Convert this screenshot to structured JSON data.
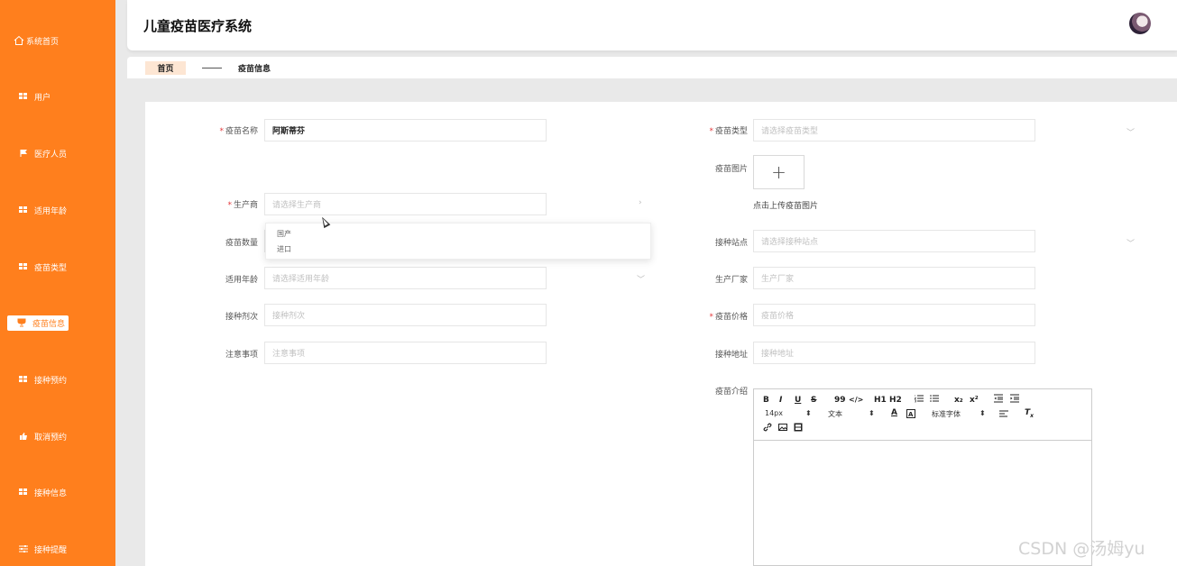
{
  "app": {
    "title": "儿童疫苗医疗系统"
  },
  "sidebar": {
    "items": [
      {
        "label": "系统首页",
        "icon": "home-icon"
      },
      {
        "label": "用户",
        "icon": "grid-icon"
      },
      {
        "label": "医疗人员",
        "icon": "flag-icon"
      },
      {
        "label": "适用年龄",
        "icon": "grid-icon"
      },
      {
        "label": "疫苗类型",
        "icon": "grid-icon"
      },
      {
        "label": "疫苗信息",
        "icon": "cup-icon"
      },
      {
        "label": "接种预约",
        "icon": "grid-icon"
      },
      {
        "label": "取消预约",
        "icon": "thumb-icon"
      },
      {
        "label": "接种信息",
        "icon": "grid-icon"
      },
      {
        "label": "接种提醒",
        "icon": "sliders-icon"
      }
    ],
    "active": "疫苗信息",
    "color": "#ff7f1d"
  },
  "breadcrumb": {
    "home": "首页",
    "current": "疫苗信息"
  },
  "form": {
    "vaccine_name": {
      "label": "疫苗名称",
      "value": "阿斯蒂芬"
    },
    "vaccine_type": {
      "label": "疫苗类型",
      "placeholder": "请选择疫苗类型"
    },
    "vaccine_image": {
      "label": "疫苗图片",
      "upload_symbol": "+",
      "tip": "点击上传疫苗图片"
    },
    "manufacturer": {
      "label": "生产商",
      "placeholder": "请选择生产商"
    },
    "manufacturer_options": [
      "国产",
      "进口"
    ],
    "quantity": {
      "label": "疫苗数量"
    },
    "station": {
      "label": "接种站点",
      "placeholder": "请选择接种站点"
    },
    "age": {
      "label": "适用年龄",
      "placeholder": "请选择适用年龄"
    },
    "factory": {
      "label": "生产厂家",
      "placeholder": "生产厂家"
    },
    "doses": {
      "label": "接种剂次",
      "placeholder": "接种剂次"
    },
    "price": {
      "label": "疫苗价格",
      "placeholder": "疫苗价格"
    },
    "notes": {
      "label": "注意事项",
      "placeholder": "注意事项"
    },
    "address": {
      "label": "接种地址",
      "placeholder": "接种地址"
    },
    "intro": {
      "label": "疫苗介绍"
    }
  },
  "editor": {
    "bold": "B",
    "italic": "I",
    "underline": "U",
    "strike": "S",
    "quote": "99",
    "code": "</>",
    "h1": "H1",
    "h2": "H2",
    "sub": "x₂",
    "sup": "x²",
    "size": "14px",
    "text": "文本",
    "font": "标准字体"
  },
  "watermark": "CSDN @汤姆yu"
}
